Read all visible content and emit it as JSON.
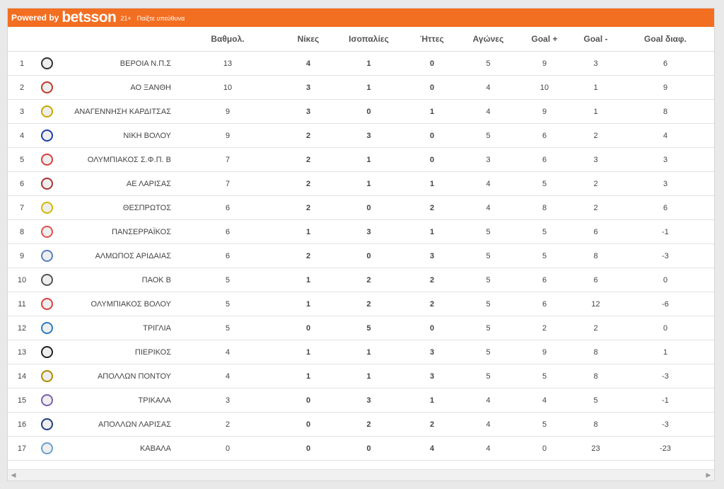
{
  "banner": {
    "powered_by": "Powered by",
    "brand": "betsson",
    "age": "21+",
    "responsible": "Παίξτε υπεύθυνα",
    "color": "#f26e21"
  },
  "columns": [
    "",
    "",
    "",
    "Βαθμολ.",
    "Νίκες",
    "Ισοπαλίες",
    "Ήττες",
    "Αγώνες",
    "Goal +",
    "Goal -",
    "Goal διαφ."
  ],
  "rows": [
    {
      "pos": "1",
      "team": "ΒΕΡΟΙΑ Ν.Π.Σ",
      "logo_color": "#333",
      "pts": "13",
      "w": "4",
      "d": "1",
      "l": "0",
      "gp": "5",
      "gf": "9",
      "ga": "3",
      "gd": "6"
    },
    {
      "pos": "2",
      "team": "ΑΟ ΞΑΝΘΗ",
      "logo_color": "#c0392b",
      "pts": "10",
      "w": "3",
      "d": "1",
      "l": "0",
      "gp": "4",
      "gf": "10",
      "ga": "1",
      "gd": "9"
    },
    {
      "pos": "3",
      "team": "ΑΝΑΓΕΝΝΗΣΗ ΚΑΡΔΙΤΣΑΣ",
      "logo_color": "#c9a800",
      "pts": "9",
      "w": "3",
      "d": "0",
      "l": "1",
      "gp": "4",
      "gf": "9",
      "ga": "1",
      "gd": "8"
    },
    {
      "pos": "4",
      "team": "ΝΙΚΗ ΒΟΛΟΥ",
      "logo_color": "#1f3fa6",
      "pts": "9",
      "w": "2",
      "d": "3",
      "l": "0",
      "gp": "5",
      "gf": "6",
      "ga": "2",
      "gd": "4"
    },
    {
      "pos": "5",
      "team": "ΟΛΥΜΠΙΑΚΟΣ Σ.Φ.Π. Β",
      "logo_color": "#d94040",
      "pts": "7",
      "w": "2",
      "d": "1",
      "l": "0",
      "gp": "3",
      "gf": "6",
      "ga": "3",
      "gd": "3"
    },
    {
      "pos": "6",
      "team": "ΑΕ ΛΑΡΙΣΑΣ",
      "logo_color": "#a33",
      "pts": "7",
      "w": "2",
      "d": "1",
      "l": "1",
      "gp": "4",
      "gf": "5",
      "ga": "2",
      "gd": "3"
    },
    {
      "pos": "7",
      "team": "ΘΕΣΠΡΩΤΟΣ",
      "logo_color": "#d4b800",
      "pts": "6",
      "w": "2",
      "d": "0",
      "l": "2",
      "gp": "4",
      "gf": "8",
      "ga": "2",
      "gd": "6"
    },
    {
      "pos": "8",
      "team": "ΠΑΝΣΕΡΡΑΪΚΟΣ",
      "logo_color": "#e05050",
      "pts": "6",
      "w": "1",
      "d": "3",
      "l": "1",
      "gp": "5",
      "gf": "5",
      "ga": "6",
      "gd": "-1"
    },
    {
      "pos": "9",
      "team": "ΑΛΜΩΠΟΣ ΑΡΙΔΑΙΑΣ",
      "logo_color": "#5a7fc0",
      "pts": "6",
      "w": "2",
      "d": "0",
      "l": "3",
      "gp": "5",
      "gf": "5",
      "ga": "8",
      "gd": "-3"
    },
    {
      "pos": "10",
      "team": "ΠΑΟΚ Β",
      "logo_color": "#555",
      "pts": "5",
      "w": "1",
      "d": "2",
      "l": "2",
      "gp": "5",
      "gf": "6",
      "ga": "6",
      "gd": "0"
    },
    {
      "pos": "11",
      "team": "ΟΛΥΜΠΙΑΚΟΣ ΒΟΛΟΥ",
      "logo_color": "#d94040",
      "pts": "5",
      "w": "1",
      "d": "2",
      "l": "2",
      "gp": "5",
      "gf": "6",
      "ga": "12",
      "gd": "-6"
    },
    {
      "pos": "12",
      "team": "ΤΡΙΓΛΙΑ",
      "logo_color": "#2f7ac0",
      "pts": "5",
      "w": "0",
      "d": "5",
      "l": "0",
      "gp": "5",
      "gf": "2",
      "ga": "2",
      "gd": "0"
    },
    {
      "pos": "13",
      "team": "ΠΙΕΡΙΚΟΣ",
      "logo_color": "#222",
      "pts": "4",
      "w": "1",
      "d": "1",
      "l": "3",
      "gp": "5",
      "gf": "9",
      "ga": "8",
      "gd": "1"
    },
    {
      "pos": "14",
      "team": "ΑΠΟΛΛΩΝ ΠΟΝΤΟΥ",
      "logo_color": "#b08a00",
      "pts": "4",
      "w": "1",
      "d": "1",
      "l": "3",
      "gp": "5",
      "gf": "5",
      "ga": "8",
      "gd": "-3"
    },
    {
      "pos": "15",
      "team": "ΤΡΙΚΑΛΑ",
      "logo_color": "#7a5fb0",
      "pts": "3",
      "w": "0",
      "d": "3",
      "l": "1",
      "gp": "4",
      "gf": "4",
      "ga": "5",
      "gd": "-1"
    },
    {
      "pos": "16",
      "team": "ΑΠΟΛΛΩΝ ΛΑΡΙΣΑΣ",
      "logo_color": "#1f3f80",
      "pts": "2",
      "w": "0",
      "d": "2",
      "l": "2",
      "gp": "4",
      "gf": "5",
      "ga": "8",
      "gd": "-3"
    },
    {
      "pos": "17",
      "team": "ΚΑΒΑΛΑ",
      "logo_color": "#6aa0d0",
      "pts": "0",
      "w": "0",
      "d": "0",
      "l": "4",
      "gp": "4",
      "gf": "0",
      "ga": "23",
      "gd": "-23"
    }
  ],
  "scrollbar": {
    "left_arrow": "◀",
    "right_arrow": "▶"
  }
}
